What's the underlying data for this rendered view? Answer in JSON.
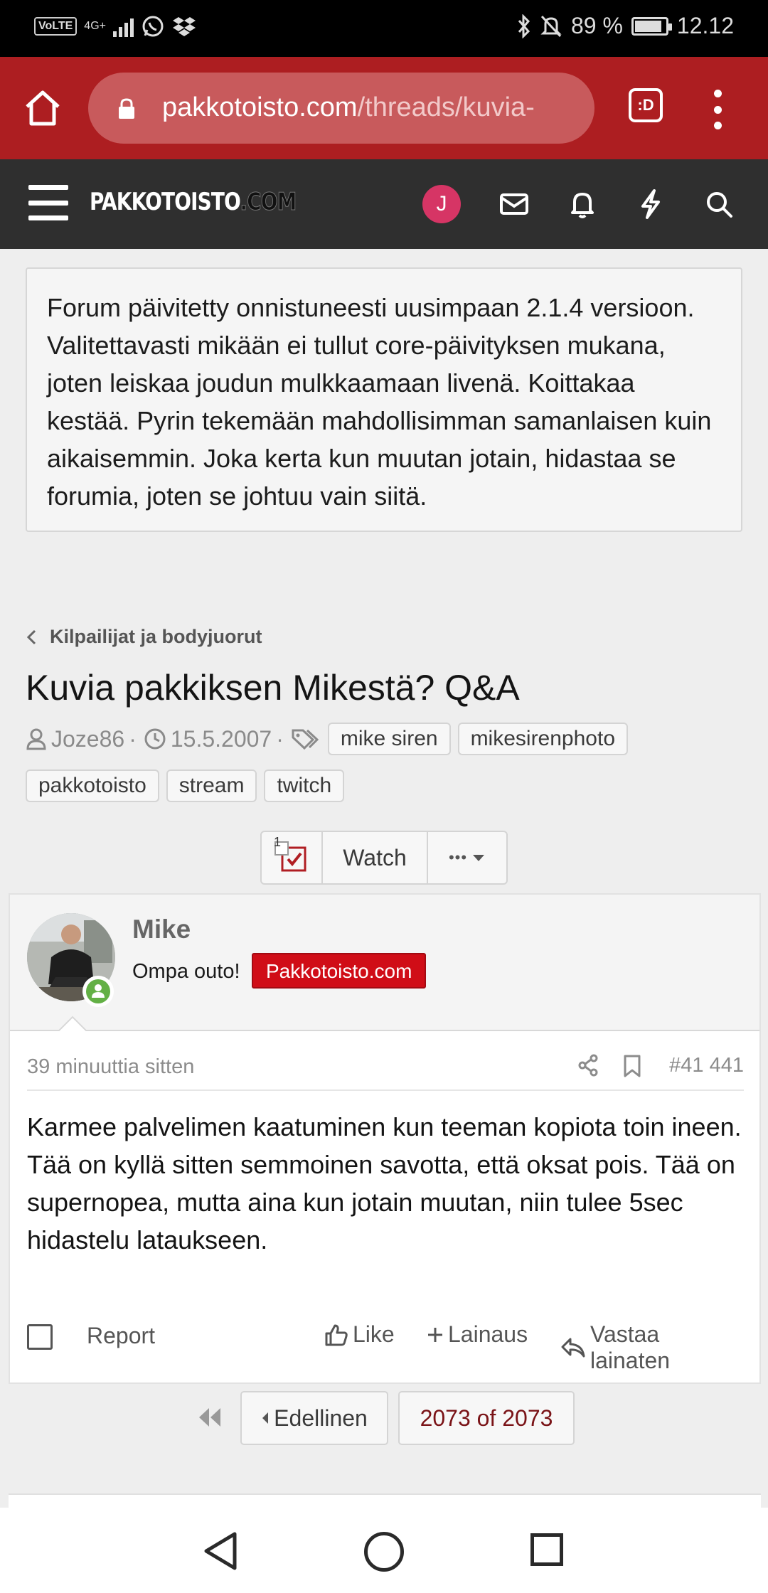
{
  "status_bar": {
    "volte": "VoLTE",
    "network": "4G+",
    "battery": "89 %",
    "battery_fraction": 0.89,
    "time": "12.12",
    "icons": [
      "whatsapp-icon",
      "dropbox-icon",
      "bluetooth-icon",
      "mute-icon",
      "battery-icon"
    ]
  },
  "browser": {
    "url_domain": "pakkotoisto.com",
    "url_path": "/threads/kuvia-",
    "tab_icon": ":D"
  },
  "site_header": {
    "logo_main": "PAKKOTOISTO",
    "logo_suffix": ".COM",
    "user_initial": "J",
    "accent": "#d63565"
  },
  "notice": {
    "text": "Forum päivitetty onnistuneesti uusimpaan 2.1.4 versioon. Valitettavasti mikään ei tullut core-päivityksen mukana, joten leiskaa joudun mulkkaamaan livenä. Koittakaa kestää. Pyrin tekemään mahdollisimman samanlaisen kuin aikaisemmin. Joka kerta kun muutan jotain, hidastaa se forumia, joten se johtuu vain siitä."
  },
  "thread": {
    "breadcrumb": "Kilpailijat ja bodyjuorut",
    "title": "Kuvia pakkiksen Mikestä? Q&A",
    "author": "Joze86",
    "date": "15.5.2007",
    "tags": [
      "mike siren",
      "mikesirenphoto",
      "pakkotoisto",
      "stream",
      "twitch"
    ]
  },
  "thread_actions": {
    "badge_count": "1",
    "watch_label": "Watch",
    "more_label": "•••"
  },
  "post": {
    "username": "Mike",
    "user_title": "Ompa outo!",
    "user_banner": "Pakkotoisto.com",
    "time": "39 minuuttia sitten",
    "number": "#41 441",
    "body": "Karmee palvelimen kaatuminen kun teeman kopiota toin ineen. Tää on kyllä sitten semmoinen savotta, että oksat pois. Tää on supernopea, mutta aina kun jotain muutan, niin tulee 5sec hidastelu lataukseen.",
    "report_label": "Report",
    "like_label": "Like",
    "quote_label": "Lainaus",
    "reply_label": "Vastaa lainaten",
    "banner_color": "#d00d17"
  },
  "pagination": {
    "prev_label": "Edellinen",
    "current_label": "2073 of 2073"
  },
  "colors": {
    "browser_bar": "#ad1e21",
    "site_header": "#2f2f2f",
    "online": "#63b045"
  }
}
